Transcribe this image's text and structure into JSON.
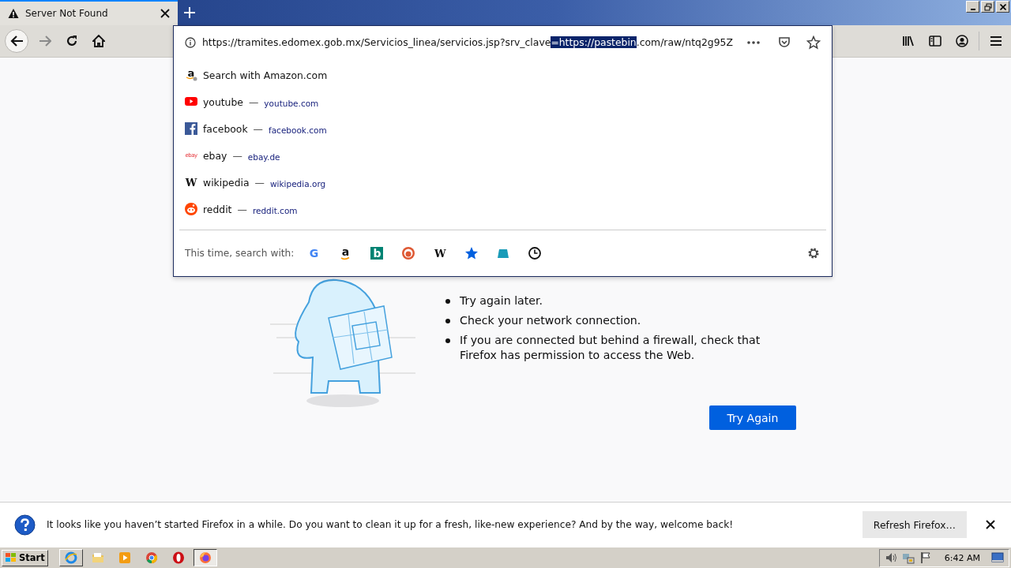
{
  "tabs": [
    {
      "label": "Server Not Found",
      "selected": true
    }
  ],
  "address_bar": {
    "url_before": "https://tramites.edomex.gob.mx/Servicios_linea/servicios.jsp?srv_clave",
    "url_selected": "=https://pastebin",
    "url_after": ".com/raw/ntq2g95Z"
  },
  "suggestions": [
    {
      "kind": "amazon",
      "glyph": "a",
      "title": "Search with Amazon.com"
    },
    {
      "kind": "youtube",
      "title": "youtube",
      "separator": "—",
      "url": "youtube.com"
    },
    {
      "kind": "facebook",
      "title": "facebook",
      "separator": "—",
      "url": "facebook.com"
    },
    {
      "kind": "ebay",
      "glyph": "ebay",
      "title": "ebay",
      "separator": "—",
      "url": "ebay.de"
    },
    {
      "kind": "wikipedia",
      "glyph": "W",
      "title": "wikipedia",
      "separator": "—",
      "url": "wikipedia.org"
    },
    {
      "kind": "reddit",
      "title": "reddit",
      "separator": "—",
      "url": "reddit.com"
    }
  ],
  "search_with": {
    "label": "This time, search with:",
    "engines": [
      {
        "kind": "google",
        "glyph": "G"
      },
      {
        "kind": "amazon",
        "glyph": "a"
      },
      {
        "kind": "bing",
        "glyph": "b"
      },
      {
        "kind": "duck"
      },
      {
        "kind": "wikipedia",
        "glyph": "W"
      },
      {
        "kind": "bookmarks"
      },
      {
        "kind": "tabs"
      },
      {
        "kind": "history"
      }
    ]
  },
  "error_page": {
    "tips": [
      "Try again later.",
      "Check your network connection.",
      "If you are connected but behind a firewall, check that Firefox has permission to access the Web."
    ],
    "button": "Try Again"
  },
  "notification": {
    "message": "It looks like you haven’t started Firefox in a while. Do you want to clean it up for a fresh, like-new experience? And by the way, welcome back!",
    "button": "Refresh Firefox…"
  },
  "taskbar": {
    "start": "Start",
    "apps": [
      {
        "kind": "ie",
        "selected": false
      },
      {
        "kind": "folder",
        "selected": false
      },
      {
        "kind": "media",
        "selected": false
      },
      {
        "kind": "chrome",
        "selected": false
      },
      {
        "kind": "opera",
        "selected": false
      },
      {
        "kind": "firefox",
        "selected": true
      }
    ],
    "clock": "6:42 AM"
  }
}
